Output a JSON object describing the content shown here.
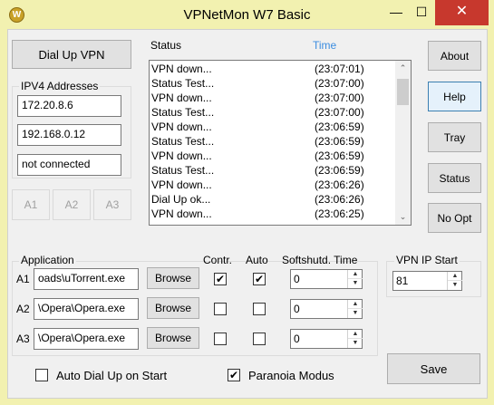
{
  "window": {
    "title": "VPNetMon W7 Basic",
    "app_icon": "W",
    "minimize_glyph": "—",
    "maximize_glyph": "☐",
    "close_glyph": "✕"
  },
  "left": {
    "dialup_label": "Dial Up VPN",
    "ipv4_label": "IPV4 Addresses",
    "addresses": [
      "172.20.8.6",
      "192.168.0.12",
      "not connected"
    ],
    "a_buttons": [
      "A1",
      "A2",
      "A3"
    ]
  },
  "log": {
    "status_header": "Status",
    "time_header": "Time",
    "rows": [
      {
        "msg": "VPN down...",
        "time": "(23:07:01)"
      },
      {
        "msg": "Status Test...",
        "time": "(23:07:00)"
      },
      {
        "msg": "VPN down...",
        "time": "(23:07:00)"
      },
      {
        "msg": "Status Test...",
        "time": "(23:07:00)"
      },
      {
        "msg": "VPN down...",
        "time": "(23:06:59)"
      },
      {
        "msg": "Status Test...",
        "time": "(23:06:59)"
      },
      {
        "msg": "VPN down...",
        "time": "(23:06:59)"
      },
      {
        "msg": "Status Test...",
        "time": "(23:06:59)"
      },
      {
        "msg": "VPN down...",
        "time": "(23:06:26)"
      },
      {
        "msg": "Dial Up ok...",
        "time": "(23:06:26)"
      },
      {
        "msg": "VPN down...",
        "time": "(23:06:25)"
      }
    ]
  },
  "right": {
    "about": "About",
    "help": "Help",
    "tray": "Tray",
    "status": "Status",
    "no_opt": "No Opt"
  },
  "apps": {
    "application_label": "Application",
    "contr_label": "Contr.",
    "auto_label": "Auto",
    "softshutd_label": "Softshutd. Time",
    "browse_label": "Browse",
    "rows": [
      {
        "id": "A1",
        "path": "oads\\uTorrent.exe",
        "contr": true,
        "auto": true,
        "time": "0"
      },
      {
        "id": "A2",
        "path": "\\Opera\\Opera.exe",
        "contr": false,
        "auto": false,
        "time": "0"
      },
      {
        "id": "A3",
        "path": "\\Opera\\Opera.exe",
        "contr": false,
        "auto": false,
        "time": "0"
      }
    ]
  },
  "vpn_ip_start": {
    "label": "VPN IP Start",
    "value": "81"
  },
  "bottom": {
    "auto_dial_label": "Auto Dial Up on Start",
    "auto_dial_checked": false,
    "paranoia_label": "Paranoia Modus",
    "paranoia_checked": true,
    "save_label": "Save"
  },
  "glyphs": {
    "check": "✔",
    "up": "▲",
    "down": "▼",
    "scroll_up": "⌃",
    "scroll_down": "⌄"
  },
  "colors": {
    "titlebar": "#f2f1b0",
    "close_button": "#c7382d",
    "time_header": "#3c8de0"
  }
}
